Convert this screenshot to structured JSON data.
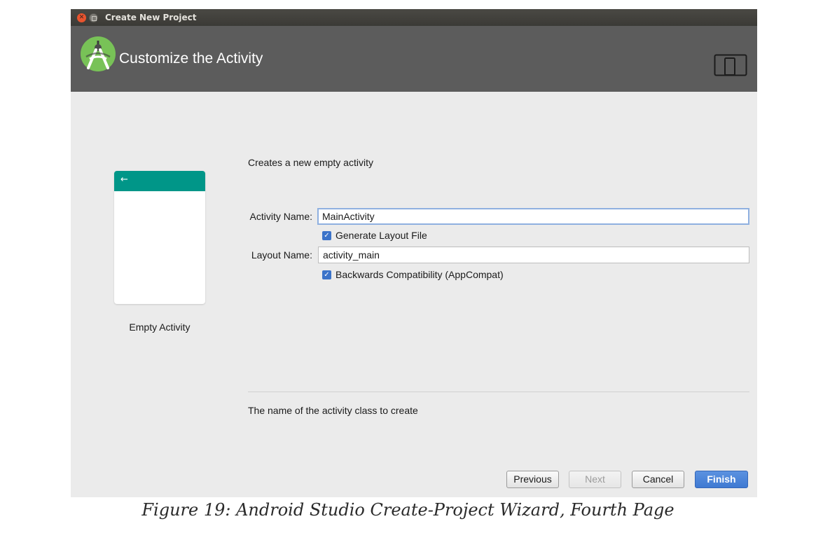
{
  "window": {
    "title": "Create New Project",
    "close_glyph": "✕",
    "controls": [
      "close-icon",
      "minimize-icon"
    ]
  },
  "header": {
    "title": "Customize the Activity",
    "logo_icon": "android-studio-logo-icon",
    "device_icon": "phone-tablet-icon",
    "background": "#5c5c5c"
  },
  "template": {
    "back_glyph": "←",
    "label": "Empty Activity",
    "appbar_color": "#009688"
  },
  "form": {
    "description": "Creates a new empty activity",
    "activity_name_label": "Activity Name:",
    "activity_name_value": "MainActivity",
    "generate_layout_label": "Generate Layout File",
    "generate_layout_checked": true,
    "layout_name_label": "Layout Name:",
    "layout_name_value": "activity_main",
    "backwards_compat_label": "Backwards Compatibility (AppCompat)",
    "backwards_compat_checked": true,
    "check_glyph": "✓"
  },
  "help": {
    "text": "The name of the activity class to create"
  },
  "buttons": {
    "previous": "Previous",
    "next": "Next",
    "cancel": "Cancel",
    "finish": "Finish",
    "next_enabled": false,
    "accent": "#3f79d2"
  },
  "caption": {
    "text": "Figure 19: Android Studio Create-Project Wizard, Fourth Page"
  }
}
